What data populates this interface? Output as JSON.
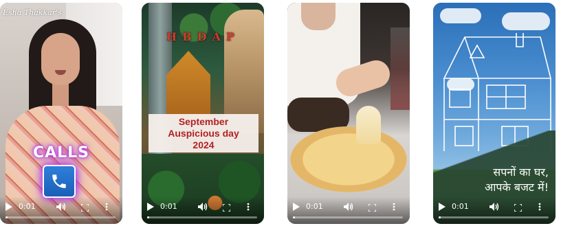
{
  "videos": [
    {
      "overlay": {
        "logo": "Esha Thakkar's",
        "callout": "CALLS"
      },
      "player": {
        "time": "0:01",
        "progress": 0.02
      }
    },
    {
      "overlay": {
        "art_text": "HBDAP",
        "lines": [
          "September",
          "Auspicious day",
          "2024"
        ]
      },
      "player": {
        "time": "0:01",
        "progress": 0.02
      }
    },
    {
      "overlay": {},
      "player": {
        "time": "0:01",
        "progress": 0.02
      }
    },
    {
      "overlay": {
        "lines": [
          "सपनों का घर,",
          "आपके बजट में!"
        ]
      },
      "player": {
        "time": "0:01",
        "progress": 0.02
      }
    }
  ],
  "colors": {
    "callout_glow": "#c23cff",
    "panel_text": "#b32121",
    "phone_blue": "#2f7fd9"
  },
  "icons": [
    "play-icon",
    "volume-icon",
    "fullscreen-icon",
    "more-vert-icon",
    "phone-icon"
  ]
}
